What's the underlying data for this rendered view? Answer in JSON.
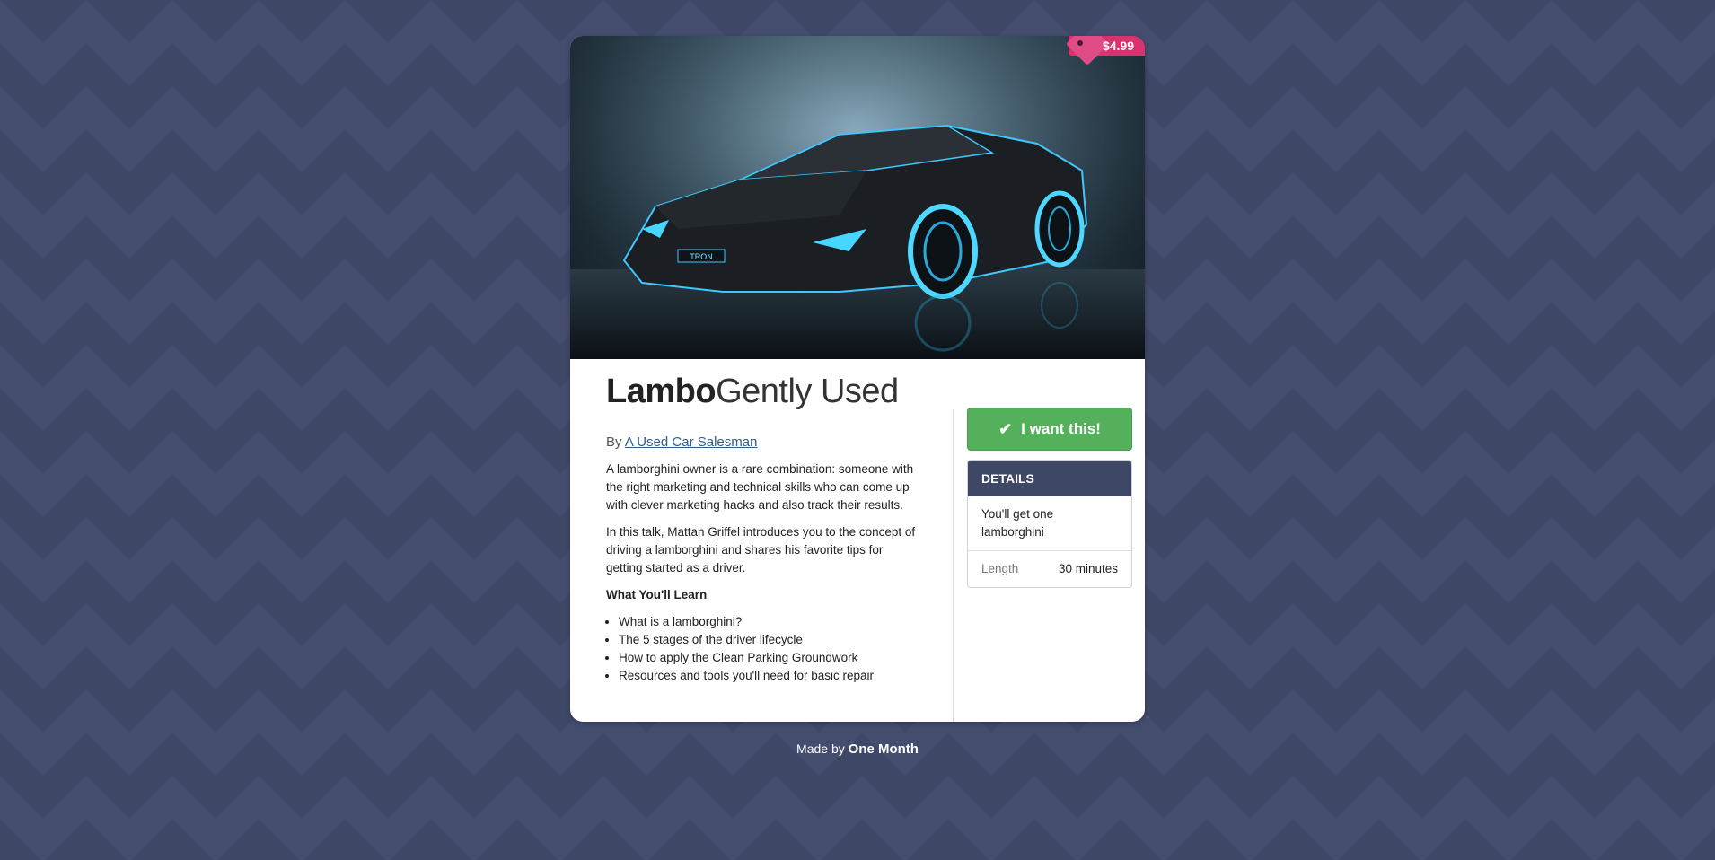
{
  "product": {
    "title_bold": "Lambo",
    "title_light": "Gently Used",
    "price": "$4.99",
    "byline_prefix": "By",
    "author": "A Used Car Salesman",
    "hero_plate": "TRON"
  },
  "description": {
    "paragraphs": [
      "A lamborghini owner is a rare combination: someone with the right marketing and technical skills who can come up with clever marketing hacks and also track their results.",
      "In this talk, Mattan Griffel introduces you to the concept of driving a lamborghini and shares his favorite tips for getting started as a driver."
    ],
    "learn_heading": "What You'll Learn",
    "learn_items": [
      "What is a lamborghini?",
      "The 5 stages of the driver lifecycle",
      "How to apply the Clean Parking Groundwork",
      "Resources and tools you'll need for basic repair"
    ]
  },
  "sidebar": {
    "buy_label": "I want this!",
    "details_header": "DETAILS",
    "details_summary": "You'll get one lamborghini",
    "length_label": "Length",
    "length_value": "30 minutes"
  },
  "footer": {
    "prefix": "Made by",
    "brand": "One Month"
  },
  "colors": {
    "accent_green": "#55b05c",
    "price_pink": "#d8336f",
    "navy": "#3f4767"
  }
}
